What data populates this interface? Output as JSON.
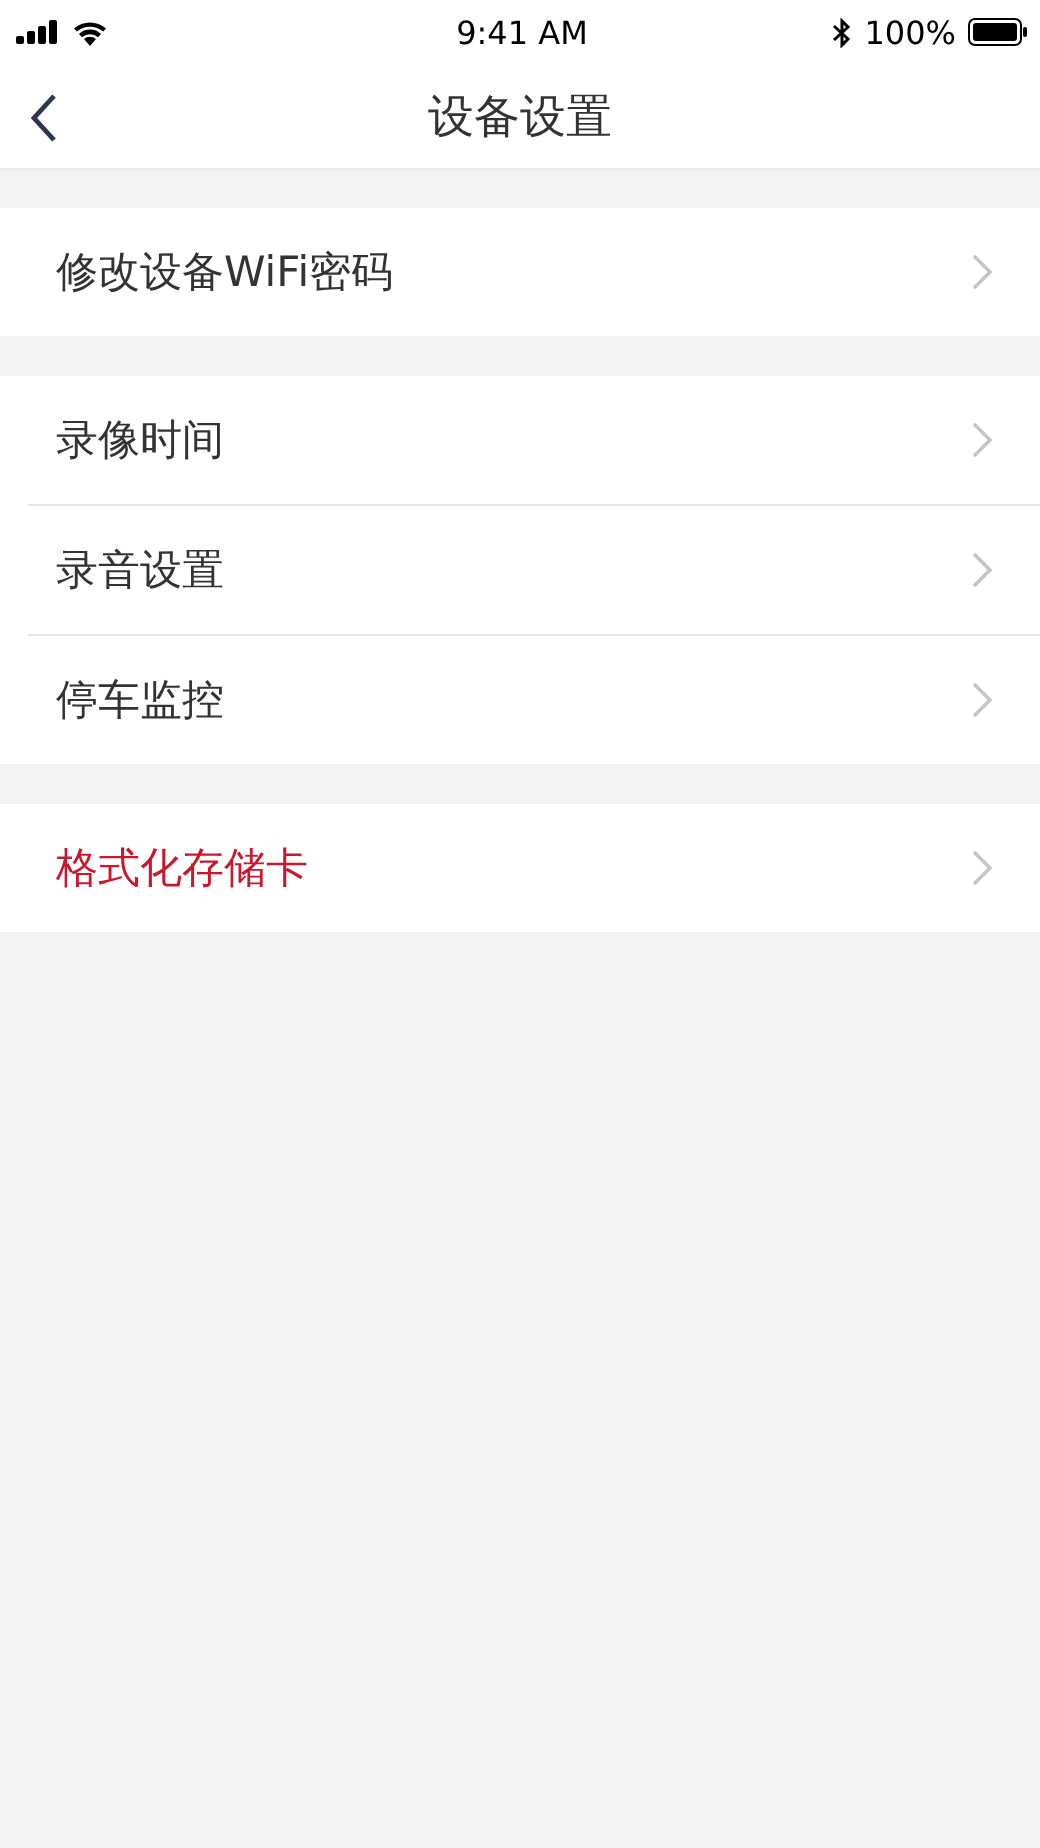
{
  "status_bar": {
    "time": "9:41 AM",
    "battery": "100%"
  },
  "nav": {
    "title": "设备设置"
  },
  "groups": [
    {
      "items": [
        {
          "label": "修改设备WiFi密码",
          "kind": "normal"
        }
      ]
    },
    {
      "items": [
        {
          "label": "录像时间",
          "kind": "normal"
        },
        {
          "label": "录音设置",
          "kind": "normal"
        },
        {
          "label": "停车监控",
          "kind": "normal"
        }
      ]
    },
    {
      "items": [
        {
          "label": "格式化存储卡",
          "kind": "danger"
        }
      ]
    }
  ]
}
